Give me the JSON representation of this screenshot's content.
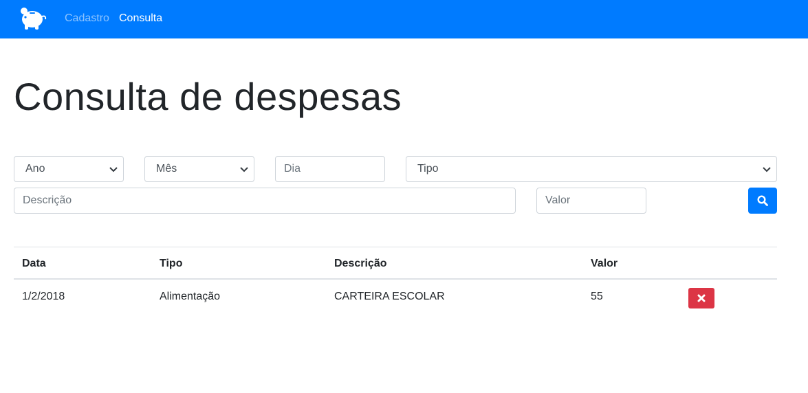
{
  "navbar": {
    "logo_icon": "piggy-bank-icon",
    "links": [
      {
        "label": "Cadastro",
        "active": false
      },
      {
        "label": "Consulta",
        "active": true
      }
    ],
    "background": "#007bff"
  },
  "page": {
    "title": "Consulta de despesas"
  },
  "filters": {
    "ano": {
      "value": "Ano",
      "type": "select"
    },
    "mes": {
      "value": "Mês",
      "type": "select"
    },
    "dia": {
      "placeholder": "Dia",
      "type": "input"
    },
    "tipo": {
      "value": "Tipo",
      "type": "select"
    },
    "descricao": {
      "placeholder": "Descrição",
      "type": "input"
    },
    "valor": {
      "placeholder": "Valor",
      "type": "input"
    },
    "search_button_icon": "search-icon"
  },
  "table": {
    "headers": [
      "Data",
      "Tipo",
      "Descrição",
      "Valor"
    ],
    "rows": [
      {
        "data": "1/2/2018",
        "tipo": "Alimentação",
        "descricao": "CARTEIRA ESCOLAR",
        "valor": "55",
        "action_icon": "close-icon"
      }
    ]
  },
  "colors": {
    "primary": "#007bff",
    "danger": "#dc3545"
  }
}
